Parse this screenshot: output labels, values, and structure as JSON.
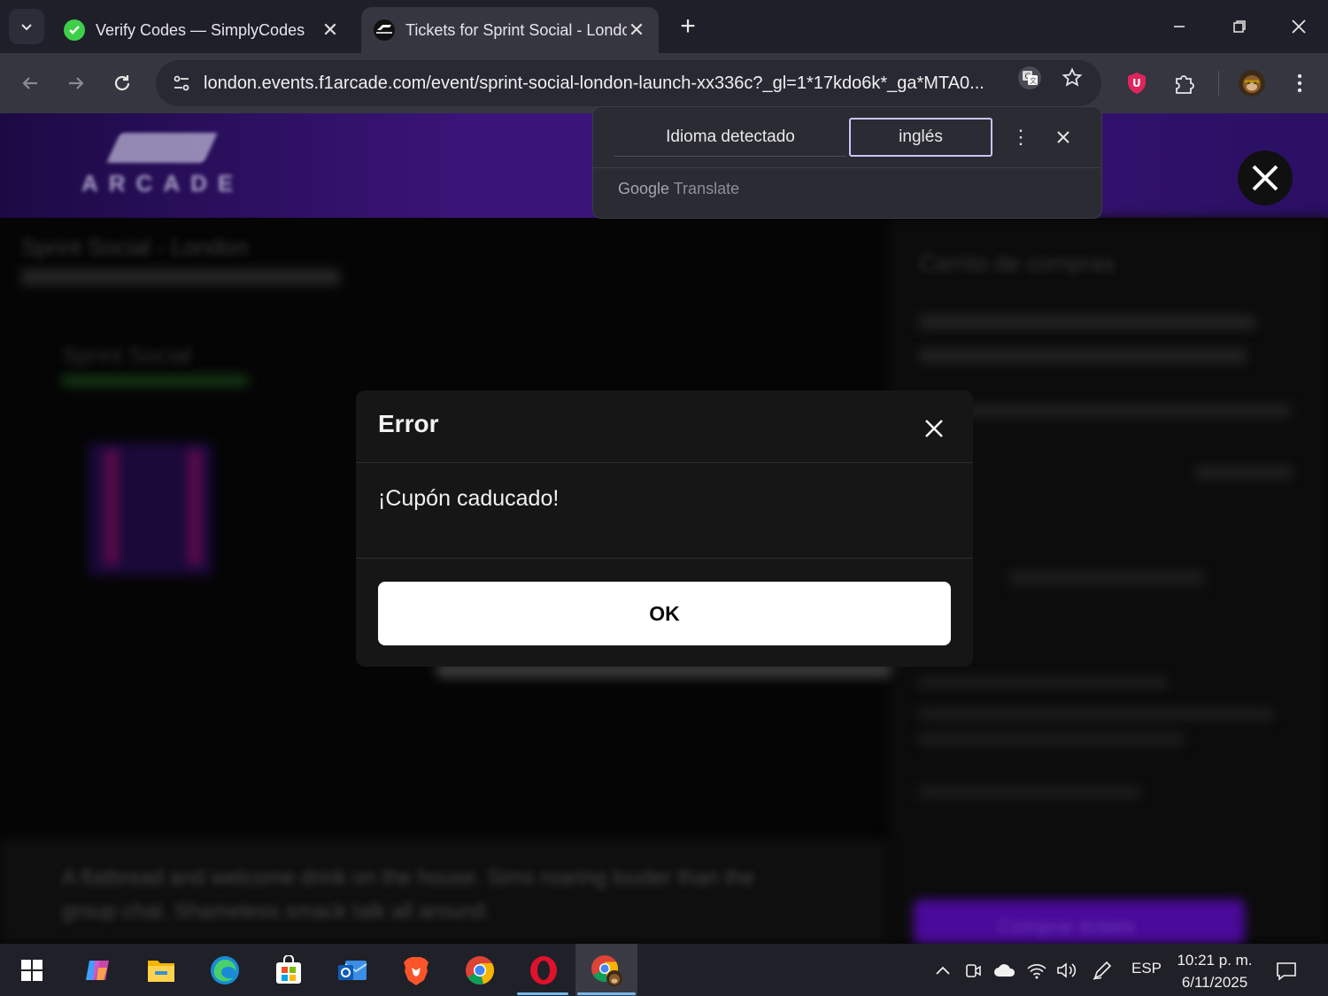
{
  "browser": {
    "tabs": [
      {
        "title": "Verify Codes — SimplyCodes",
        "active": false
      },
      {
        "title": "Tickets for Sprint Social - London",
        "active": true
      }
    ],
    "address_bar": {
      "url": "london.events.f1arcade.com/event/sprint-social-london-launch-xx336c?_gl=1*17kdo6k*_ga*MTA0..."
    }
  },
  "translate_popup": {
    "detected_label": "Idioma detectado",
    "language_label": "inglés",
    "brand_google": "Google",
    "brand_translate": "Translate"
  },
  "page": {
    "logo_text": "ARCADE",
    "background_text": [
      "Sprint Social - London",
      "Carrito de compras",
      "Sprint Social",
      "Comprar tickets",
      "A flatbread and welcome drink on the house. Sims roaring louder than the",
      "group chat. Shameless smack talk all around."
    ]
  },
  "modal": {
    "title": "Error",
    "message": "¡Cupón caducado!",
    "ok_label": "OK"
  },
  "taskbar": {
    "language": "ESP",
    "time": "10:21 p. m.",
    "date": "6/11/2025"
  },
  "colors": {
    "modal_bg": "#161616",
    "ok_button_bg": "#ffffff",
    "header_purple": "#3b147a",
    "translate_highlight": "#c8c4ff"
  }
}
